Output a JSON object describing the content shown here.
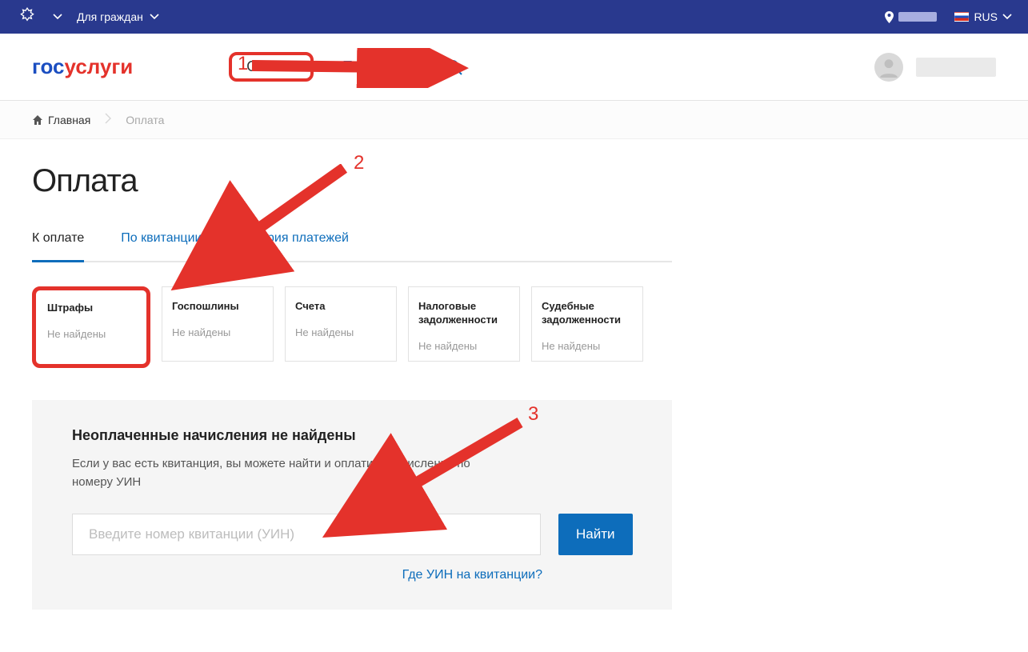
{
  "topbar": {
    "audience_label": "Для граждан",
    "lang_label": "RUS"
  },
  "logo": {
    "part1": "гос",
    "part2": "услуги"
  },
  "nav": {
    "payment": "Оплата",
    "support": "Поддержка"
  },
  "breadcrumb": {
    "home": "Главная",
    "current": "Оплата"
  },
  "page_title": "Оплата",
  "tabs": {
    "to_pay": "К оплате",
    "by_receipt": "По квитанции",
    "history": "История платежей"
  },
  "cards": [
    {
      "title": "Штрафы",
      "status": "Не найдены"
    },
    {
      "title": "Госпошлины",
      "status": "Не найдены"
    },
    {
      "title": "Счета",
      "status": "Не найдены"
    },
    {
      "title": "Налоговые задолженности",
      "status": "Не найдены"
    },
    {
      "title": "Судебные задолженности",
      "status": "Не найдены"
    }
  ],
  "panel": {
    "title": "Неоплаченные начисления не найдены",
    "text": "Если у вас есть квитанция, вы можете найти и оплатить начисления по номеру УИН",
    "input_placeholder": "Введите номер квитанции (УИН)",
    "find_label": "Найти",
    "help_label": "Где УИН на квитанции?"
  },
  "annotations": {
    "n1": "1",
    "n2": "2",
    "n3": "3"
  }
}
